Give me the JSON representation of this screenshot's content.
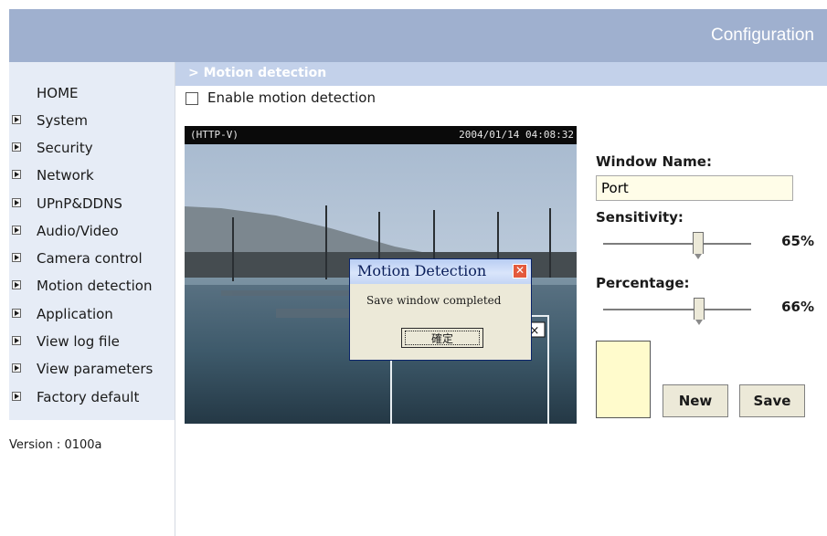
{
  "header": {
    "title": "Configuration"
  },
  "sidebar": {
    "home": "HOME",
    "items": [
      {
        "label": "System"
      },
      {
        "label": "Security"
      },
      {
        "label": "Network"
      },
      {
        "label": "UPnP&DDNS"
      },
      {
        "label": "Audio/Video"
      },
      {
        "label": "Camera control"
      },
      {
        "label": "Motion detection"
      },
      {
        "label": "Application"
      },
      {
        "label": "View log file"
      },
      {
        "label": "View parameters"
      },
      {
        "label": "Factory default"
      }
    ],
    "version": "Version : 0100a",
    "arrow_icon": "arrow-right-box-icon"
  },
  "section": {
    "title": "> Motion detection"
  },
  "enable_motion": {
    "label": "Enable motion detection",
    "checked": false
  },
  "video": {
    "source": "(HTTP-V)",
    "timestamp": "2004/01/14 04:08:32"
  },
  "dialog": {
    "title": "Motion Detection",
    "message": "Save window completed",
    "ok_label": "確定",
    "close_icon": "close-icon"
  },
  "window_panel": {
    "name_label": "Window Name:",
    "name_value": "Port",
    "sensitivity_label": "Sensitivity:",
    "sensitivity_value": "65%",
    "sensitivity_level": 65,
    "percentage_label": "Percentage:",
    "percentage_value": "66%",
    "percentage_level": 66,
    "window_color": "#fffbcc",
    "new_label": "New",
    "save_label": "Save"
  }
}
